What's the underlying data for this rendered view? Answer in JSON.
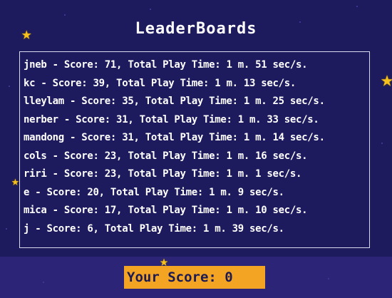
{
  "title": "LeaderBoards",
  "leaderboard": [
    {
      "text": "jneb - Score: 71, Total Play Time: 1 m. 51 sec/s."
    },
    {
      "text": "kc - Score: 39, Total Play Time: 1 m. 13 sec/s."
    },
    {
      "text": "lleylam - Score: 35, Total Play Time: 1 m. 25 sec/s."
    },
    {
      "text": "nerber - Score: 31, Total Play Time: 1 m. 33 sec/s."
    },
    {
      "text": "mandong - Score: 31, Total Play Time: 1 m. 14 sec/s."
    },
    {
      "text": "cols - Score: 23, Total Play Time: 1 m. 16 sec/s."
    },
    {
      "text": "riri - Score: 23, Total Play Time: 1 m. 1 sec/s."
    },
    {
      "text": "e - Score: 20, Total Play Time: 1 m. 9 sec/s."
    },
    {
      "text": "mica - Score: 17, Total Play Time: 1 m. 10 sec/s."
    },
    {
      "text": "j - Score: 6, Total Play Time: 1 m. 39 sec/s."
    }
  ],
  "your_score": "Your Score: 0",
  "icons": {
    "star": "star-icon"
  },
  "colors": {
    "background": "#1d1b5e",
    "text": "#ffffff",
    "score_box": "#f4a423",
    "star": "#f6c11d"
  }
}
